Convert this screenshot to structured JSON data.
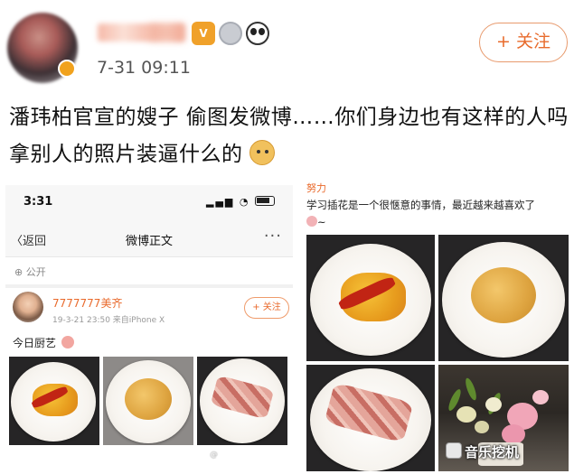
{
  "post": {
    "time": "7-31 09:11",
    "follow_label": "+ 关注",
    "text": "潘玮柏官宣的嫂子 偷图发微博……你们身边也有这样的人吗 拿别人的照片装逼什么的"
  },
  "phone": {
    "status_time": "3:31",
    "nav_back": "〈返回",
    "nav_title": "微博正文",
    "nav_more": "···",
    "public_label": "公开",
    "author_name": "7777777美齐",
    "meta": "19-3-21 23:50  来自iPhone X",
    "follow_label": "+ 关注",
    "text": "今日厨艺",
    "watermark": "@"
  },
  "right": {
    "author_name": "努力",
    "text": "学习插花是一个很惬意的事情，最近越来越喜欢了",
    "text_tail": "~"
  },
  "watermark": {
    "site_name": "音乐挖机"
  },
  "colors": {
    "accent": "#e86b2c",
    "follow_border": "#e89a6d"
  },
  "icons": [
    "avatar",
    "vip-badge-icon",
    "medal-badge-icon",
    "panda-badge-icon",
    "doge-emoji-icon",
    "signal-icon",
    "wifi-icon",
    "battery-icon",
    "globe-icon",
    "blush-emoji-icon",
    "flower-emoji-icon"
  ]
}
